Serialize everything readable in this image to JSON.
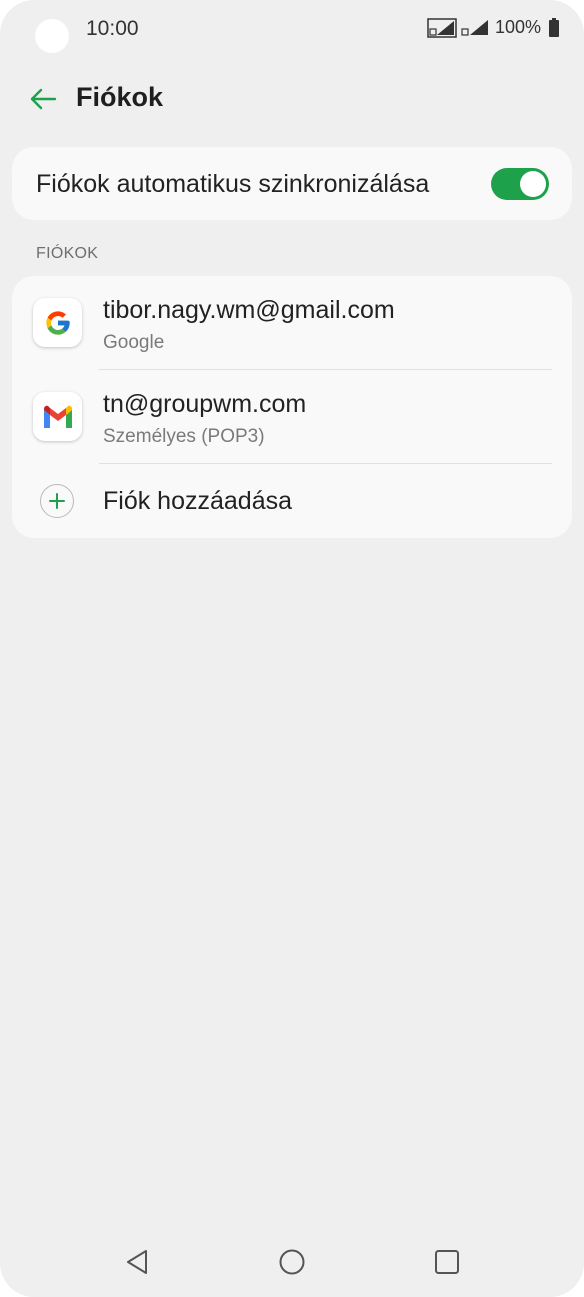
{
  "status_bar": {
    "time": "10:00",
    "battery": "100%",
    "icons": [
      "sim1-signal-icon",
      "sim2-signal-icon",
      "battery-icon"
    ]
  },
  "app_bar": {
    "back_icon": "arrow-left-icon",
    "title": "Fiókok"
  },
  "sync": {
    "label": "Fiókok automatikus szinkronizálása",
    "enabled": true
  },
  "accounts": {
    "section_title": "FIÓKOK",
    "items": [
      {
        "icon": "google-icon",
        "name": "tibor.nagy.wm@gmail.com",
        "type": "Google"
      },
      {
        "icon": "gmail-icon",
        "name": "tn@groupwm.com",
        "type": "Személyes (POP3)"
      }
    ],
    "add": {
      "icon": "plus-icon",
      "label": "Fiók hozzáadása"
    }
  },
  "nav_bar": {
    "icons": [
      "nav-back-icon",
      "nav-home-icon",
      "nav-recent-icon"
    ]
  },
  "colors": {
    "accent": "#1ea14b",
    "background": "#efefef",
    "card": "#f9f9f9"
  }
}
